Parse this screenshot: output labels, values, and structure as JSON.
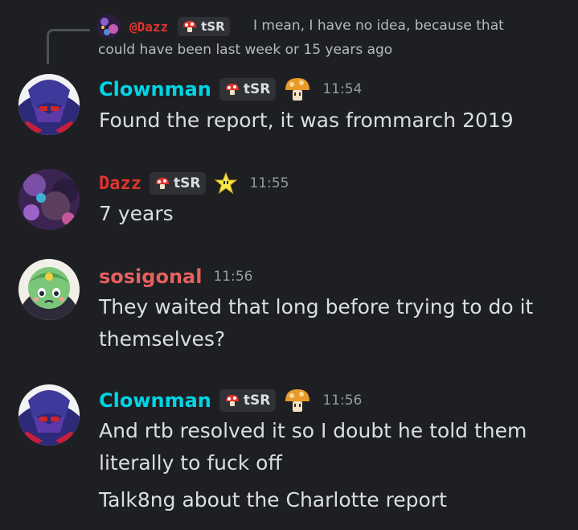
{
  "reply": {
    "author": "@Dazz",
    "tag": "tSR",
    "text": "I mean, I have no idea, because that could have been last week or 15 years ago"
  },
  "messages": [
    {
      "author": "Clownman",
      "author_color": "#00d5e6",
      "tag": "tSR",
      "badge_icon": "mushroom-emblem-icon",
      "time": "11:54",
      "lines": [
        "Found the report, it was frommarch 2019"
      ]
    },
    {
      "author": "Dazz",
      "author_color": "#e0342f",
      "tag": "tSR",
      "badge_icon": "star-icon",
      "time": "11:55",
      "lines": [
        "7 years"
      ]
    },
    {
      "author": "sosigonal",
      "author_color": "#e56060",
      "time": "11:56",
      "lines": [
        "They waited that long before trying to do it",
        "themselves?"
      ]
    },
    {
      "author": "Clownman",
      "author_color": "#00d5e6",
      "tag": "tSR",
      "badge_icon": "mushroom-emblem-icon",
      "time": "11:56",
      "lines": [
        "And rtb resolved it so I doubt he told them",
        "literally to fuck off"
      ],
      "followup": "Talk8ng about the Charlotte report"
    }
  ]
}
